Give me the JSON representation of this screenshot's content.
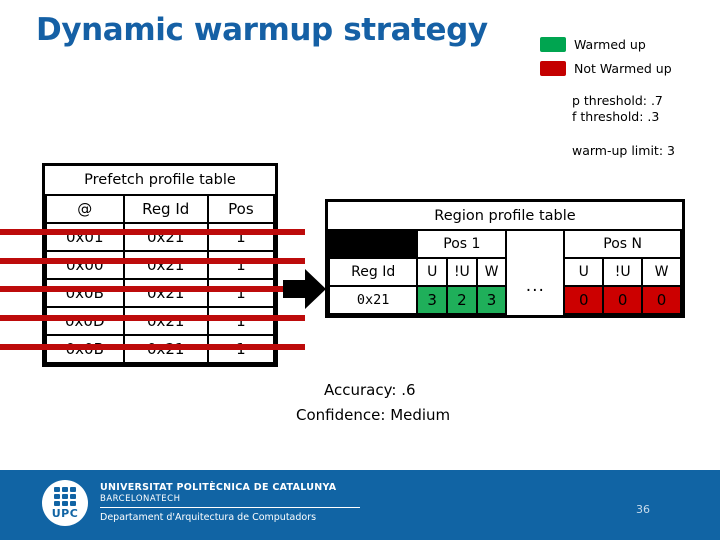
{
  "title": "Dynamic warmup strategy",
  "colors": {
    "title_blue": "#1560a5",
    "warmed_green": "#1faf5a",
    "not_warmed_red": "#cc0000",
    "strike_red": "#bd0b0b",
    "footer_blue": "#1164a4"
  },
  "legend": {
    "items": [
      {
        "label": "Warmed up",
        "color": "#00a550",
        "icon": "green-square-swatch"
      },
      {
        "label": "Not Warmed up",
        "color": "#c40000",
        "icon": "red-square-swatch"
      }
    ]
  },
  "parameters": {
    "p_threshold": "p threshold: .7",
    "f_threshold": "f threshold: .3",
    "warmup_limit": "warm-up limit: 3"
  },
  "prefetch_table": {
    "title": "Prefetch profile table",
    "columns": [
      "@",
      "Reg Id",
      "Pos"
    ],
    "rows": [
      {
        "addr": "0x01",
        "reg_id": "0x21",
        "pos": "1",
        "struck": true
      },
      {
        "addr": "0x00",
        "reg_id": "0x21",
        "pos": "1",
        "struck": true
      },
      {
        "addr": "0x0B",
        "reg_id": "0x21",
        "pos": "1",
        "struck": true
      },
      {
        "addr": "0x0D",
        "reg_id": "0x21",
        "pos": "1",
        "struck": true
      },
      {
        "addr": "0x0B",
        "reg_id": "0x21",
        "pos": "1",
        "struck": true
      }
    ]
  },
  "arrow": {
    "icon": "right-arrow-icon"
  },
  "region_table": {
    "title": "Region profile table",
    "pos1_header": "Pos 1",
    "posN_header": "Pos N",
    "reg_id_header": "Reg Id",
    "ellipsis": "...",
    "sub_headers": [
      "U",
      "!U",
      "W"
    ],
    "row": {
      "reg_id": "0x21",
      "pos1_values": [
        "3",
        "2",
        "3"
      ],
      "posN_values": [
        "0",
        "0",
        "0"
      ],
      "pos1_state": "warmed",
      "posN_state": "not-warmed"
    }
  },
  "metrics": {
    "accuracy_label": "Accuracy:",
    "accuracy_value": ".6",
    "confidence_label": "Confidence:",
    "confidence_value": "Medium"
  },
  "footer": {
    "university": "UNIVERSITAT POLITÈCNICA DE CATALUNYA",
    "barcelonatech": "BARCELONATECH",
    "department": "Departament d'Arquitectura de Computadors",
    "logo_text": "UPC",
    "page_number": "36"
  }
}
